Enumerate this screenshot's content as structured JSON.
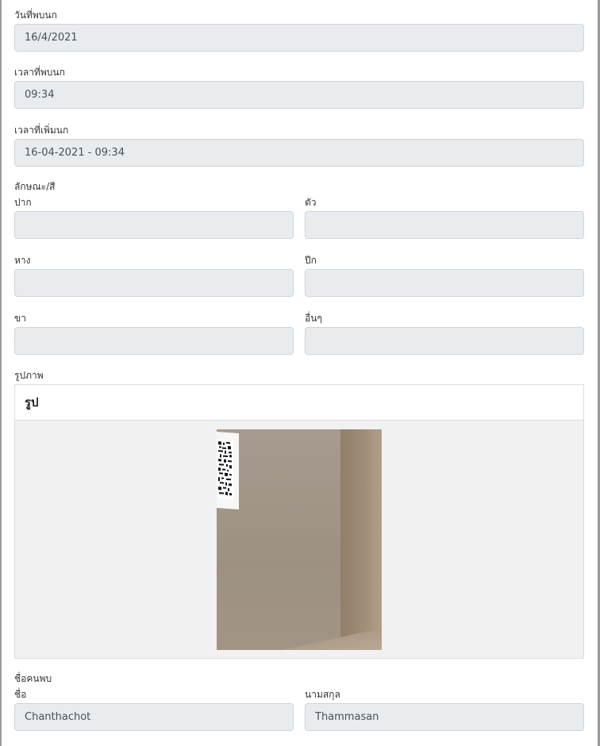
{
  "fields": {
    "date_found": {
      "label": "วันที่พบนก",
      "value": "16/4/2021"
    },
    "time_found": {
      "label": "เวลาที่พบนก",
      "value": "09:34"
    },
    "time_added": {
      "label": "เวลาที่เพิ่มนก",
      "value": "16-04-2021 - 09:34"
    }
  },
  "traits": {
    "section_label": "ลักษณะ/สี",
    "beak": {
      "label": "ปาก",
      "value": ""
    },
    "body": {
      "label": "ตัว",
      "value": ""
    },
    "tail": {
      "label": "หาง",
      "value": ""
    },
    "wing": {
      "label": "ปีก",
      "value": ""
    },
    "leg": {
      "label": "ขา",
      "value": ""
    },
    "other": {
      "label": "อื่นๆ",
      "value": ""
    }
  },
  "photo": {
    "section_label": "รูปภาพ",
    "card_title": "รูป"
  },
  "finder": {
    "section_label": "ชื่อคนพบ",
    "first_name": {
      "label": "ชื่อ",
      "value": "Chanthachot"
    },
    "last_name": {
      "label": "นามสกุล",
      "value": "Thammasan"
    }
  }
}
